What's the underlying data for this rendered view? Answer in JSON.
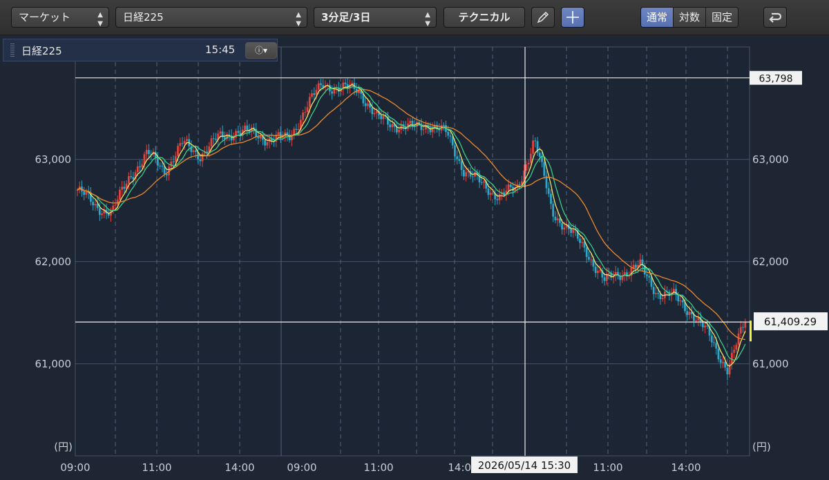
{
  "toolbar": {
    "market_select": "マーケット",
    "symbol_select": "日経225",
    "period_select": "3分足/3日",
    "technical_button": "テクニカル",
    "pencil_icon": "pencil-icon",
    "crosshair_icon": "crosshair-icon",
    "scale_modes": [
      "通常",
      "対数",
      "固定"
    ],
    "scale_selected": "通常",
    "undo_icon": "undo-icon"
  },
  "infobar": {
    "symbol": "日経225",
    "time": "15:45",
    "info_icon": "info-icon"
  },
  "colors": {
    "up": "#e0443c",
    "down": "#2aa6c8",
    "ma_short": "#f2e86a",
    "ma_mid": "#3ccf8a",
    "ma_long": "#f08a2a",
    "bg": "#1e2633"
  },
  "chart_data": {
    "type": "candlestick",
    "title": "",
    "y_unit": "(円)",
    "ylim": [
      60100,
      64100
    ],
    "y_ticks": [
      61000,
      62000,
      63000
    ],
    "y_tick_labels": [
      "61,000",
      "62,000",
      "63,000"
    ],
    "x_tick_labels": [
      "09:00",
      "11:00",
      "14:00",
      "09:00",
      "11:00",
      "14:00",
      "11:00",
      "14:00"
    ],
    "grid": true,
    "high_line": {
      "value": 63798,
      "label": "63,798"
    },
    "last_price": {
      "value": 61409.29,
      "label": "61,409.29"
    },
    "crosshair": {
      "date_label": "2026/05/14 15:30",
      "value": 61409.29
    },
    "series": [
      {
        "name": "",
        "x": [
          "d1 09:00",
          "d1 09:30",
          "d1 10:00",
          "d1 10:30",
          "d1 11:00",
          "d1 11:30",
          "d1 12:30",
          "d1 13:00",
          "d1 13:30",
          "d1 14:00",
          "d1 14:30",
          "d1 15:00",
          "d1 15:30",
          "d2 09:00",
          "d2 09:30",
          "d2 10:00",
          "d2 10:30",
          "d2 11:00",
          "d2 11:30",
          "d2 12:30",
          "d2 13:00",
          "d2 13:30",
          "d2 14:00",
          "d2 14:30",
          "d2 15:00",
          "d2 15:30",
          "d3 09:00",
          "d3 09:30",
          "d3 10:00",
          "d3 10:30",
          "d3 11:00",
          "d3 11:30",
          "d3 12:30",
          "d3 13:00",
          "d3 13:30",
          "d3 14:00",
          "d3 14:30",
          "d3 15:00",
          "d3 15:30"
        ],
        "values": [
          62700,
          62550,
          62480,
          62850,
          63050,
          62900,
          63150,
          63050,
          63200,
          63280,
          63250,
          63200,
          63200,
          63500,
          63750,
          63680,
          63700,
          63400,
          63350,
          63300,
          63350,
          63250,
          62900,
          62750,
          62650,
          62700,
          63200,
          62500,
          62300,
          62100,
          61800,
          61900,
          61950,
          61700,
          61650,
          61500,
          61250,
          60950,
          61409.29
        ]
      }
    ]
  }
}
